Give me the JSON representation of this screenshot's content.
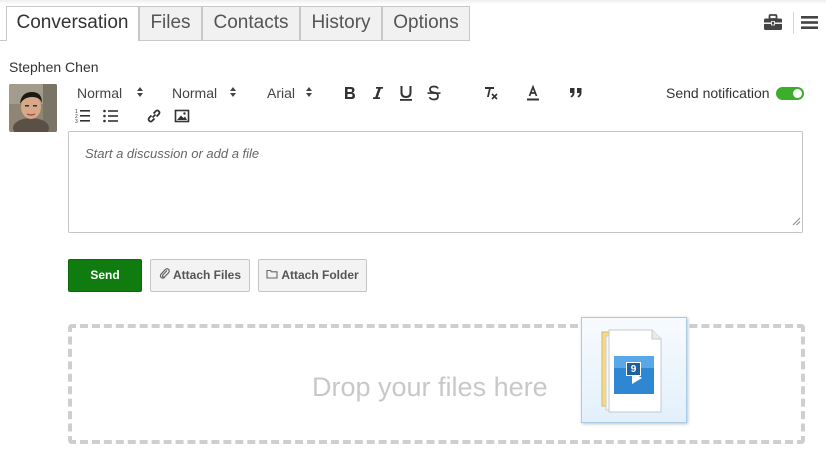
{
  "tabs": [
    {
      "label": "Conversation",
      "active": true
    },
    {
      "label": "Files",
      "active": false
    },
    {
      "label": "Contacts",
      "active": false
    },
    {
      "label": "History",
      "active": false
    },
    {
      "label": "Options",
      "active": false
    }
  ],
  "header_icons": [
    "briefcase-icon",
    "hamburger-menu-icon"
  ],
  "user": {
    "name": "Stephen Chen"
  },
  "toolbar": {
    "format_select": "Normal",
    "size_select": "Normal",
    "font_select": "Arial",
    "format_icons": [
      "bold-icon",
      "italic-icon",
      "underline-icon",
      "strikethrough-icon",
      "clear-format-icon",
      "font-color-icon",
      "blockquote-icon",
      "ordered-list-icon",
      "bullet-list-icon",
      "link-icon",
      "image-icon"
    ]
  },
  "notification": {
    "label": "Send notification",
    "enabled": true
  },
  "editor": {
    "placeholder": "Start a discussion or add a file"
  },
  "actions": {
    "send_label": "Send",
    "attach_files_label": "Attach Files",
    "attach_folder_label": "Attach Folder"
  },
  "dropzone": {
    "text": "Drop your files here"
  },
  "drag_ghost": {
    "badge": "9"
  },
  "colors": {
    "accent_green": "#107c10",
    "toggle_green": "#3dae2b",
    "dropzone_border": "#cfcfcf"
  }
}
